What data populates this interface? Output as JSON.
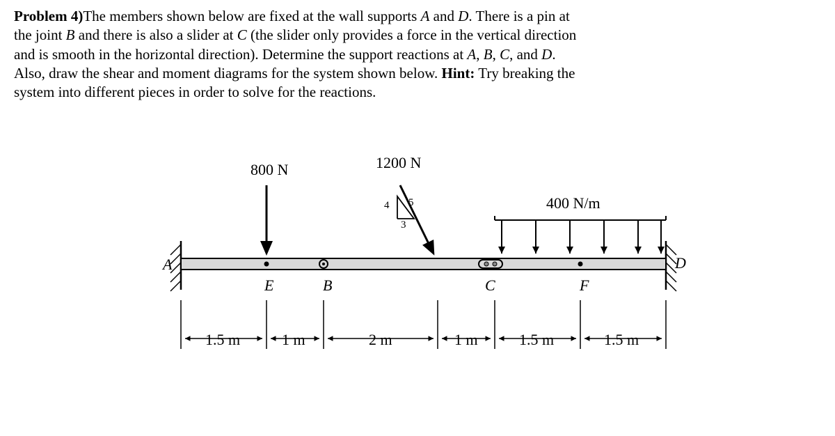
{
  "problem": {
    "lead": "Problem 4)",
    "body_line1": "The members shown below are fixed at the wall supports ",
    "A": "A",
    "and1": " and ",
    "D": "D",
    "body_after_D": ". There is a pin at",
    "body_line2a": "the joint ",
    "B": "B",
    "body_line2b": " and there is also a slider at ",
    "C": "C",
    "body_line2c": " (the slider only provides a force in the vertical direction",
    "body_line3": "and is smooth in the horizontal direction). Determine the support reactions at ",
    "A2": "A",
    "comma1": ", ",
    "B2": "B",
    "comma2": ", ",
    "C2": "C",
    "comma3": ", and ",
    "D2": "D",
    "period": ".",
    "body_line4": "Also, draw the shear and moment diagrams for the system shown below. ",
    "hint_label": "Hint:",
    "hint_text": " Try breaking the",
    "body_line5": "system into different pieces in order to solve for the reactions."
  },
  "figure": {
    "forces": {
      "p800": "800 N",
      "p1200": "1200 N",
      "w400": "400 N/m"
    },
    "triangle": {
      "rise": "4",
      "run": "3",
      "hyp": "5"
    },
    "points": {
      "A": "A",
      "B": "B",
      "C": "C",
      "D": "D",
      "E": "E",
      "F": "F"
    },
    "dims": {
      "d1": "1.5 m",
      "d2": "1 m",
      "d3": "2 m",
      "d4": "1 m",
      "d5": "1.5 m",
      "d6": "1.5 m"
    }
  },
  "chart_data": {
    "type": "diagram",
    "beam": {
      "total_length_m": 8.5,
      "supports": {
        "A": {
          "x_m": 0.0,
          "type": "fixed"
        },
        "B": {
          "x_m": 2.5,
          "type": "pin"
        },
        "C": {
          "x_m": 5.5,
          "type": "slider (vertical force only)"
        },
        "D": {
          "x_m": 8.5,
          "type": "fixed"
        }
      },
      "points": {
        "E": {
          "x_m": 1.5
        },
        "F": {
          "x_m": 7.0
        }
      },
      "loads": [
        {
          "kind": "point",
          "mag_N": 800,
          "x_m": 1.5,
          "direction": "down"
        },
        {
          "kind": "point",
          "mag_N": 1200,
          "x_m": 4.5,
          "slope_rise": 4,
          "slope_run": 3,
          "slope_hyp": 5,
          "direction": "down-left-diagonal"
        },
        {
          "kind": "distributed",
          "mag_N_per_m": 400,
          "x_start_m": 5.5,
          "x_end_m": 8.5,
          "direction": "down"
        }
      ],
      "segments_m": [
        1.5,
        1.0,
        2.0,
        1.0,
        1.5,
        1.5
      ]
    }
  }
}
